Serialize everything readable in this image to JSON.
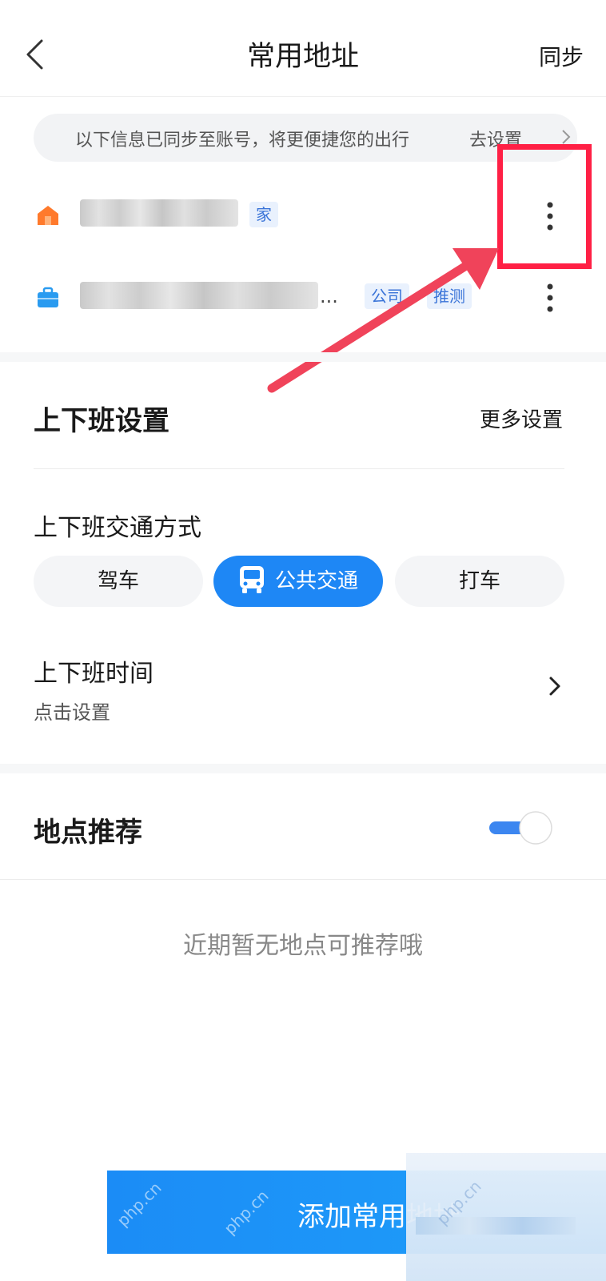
{
  "header": {
    "title": "常用地址",
    "sync_label": "同步",
    "back_icon": "chevron-left-icon"
  },
  "banner": {
    "text": "以下信息已同步至账号，将更便捷您的出行",
    "link": "去设置"
  },
  "addresses": [
    {
      "icon": "home-icon",
      "icon_color": "#ff7a2c",
      "tags": [
        "家"
      ]
    },
    {
      "icon": "briefcase-icon",
      "icon_color": "#2a9bf0",
      "tags": [
        "公司",
        "推测"
      ],
      "truncated": "..."
    }
  ],
  "commute": {
    "title": "上下班设置",
    "more_link": "更多设置",
    "mode_title": "上下班交通方式",
    "modes": [
      "驾车",
      "公共交通",
      "打车"
    ],
    "selected_mode": "公共交通",
    "time_title": "上下班时间",
    "time_value": "点击设置"
  },
  "recommend": {
    "title": "地点推荐",
    "enabled": true,
    "empty_text": "近期暂无地点可推荐哦"
  },
  "footer": {
    "add_button": "添加常用地址",
    "watermarks": [
      "php.cn",
      "php.cn",
      "php.cn"
    ]
  },
  "colors": {
    "accent": "#1e87f5",
    "highlight": "#ff2045",
    "home": "#ff7a2c",
    "work": "#2a9bf0"
  }
}
